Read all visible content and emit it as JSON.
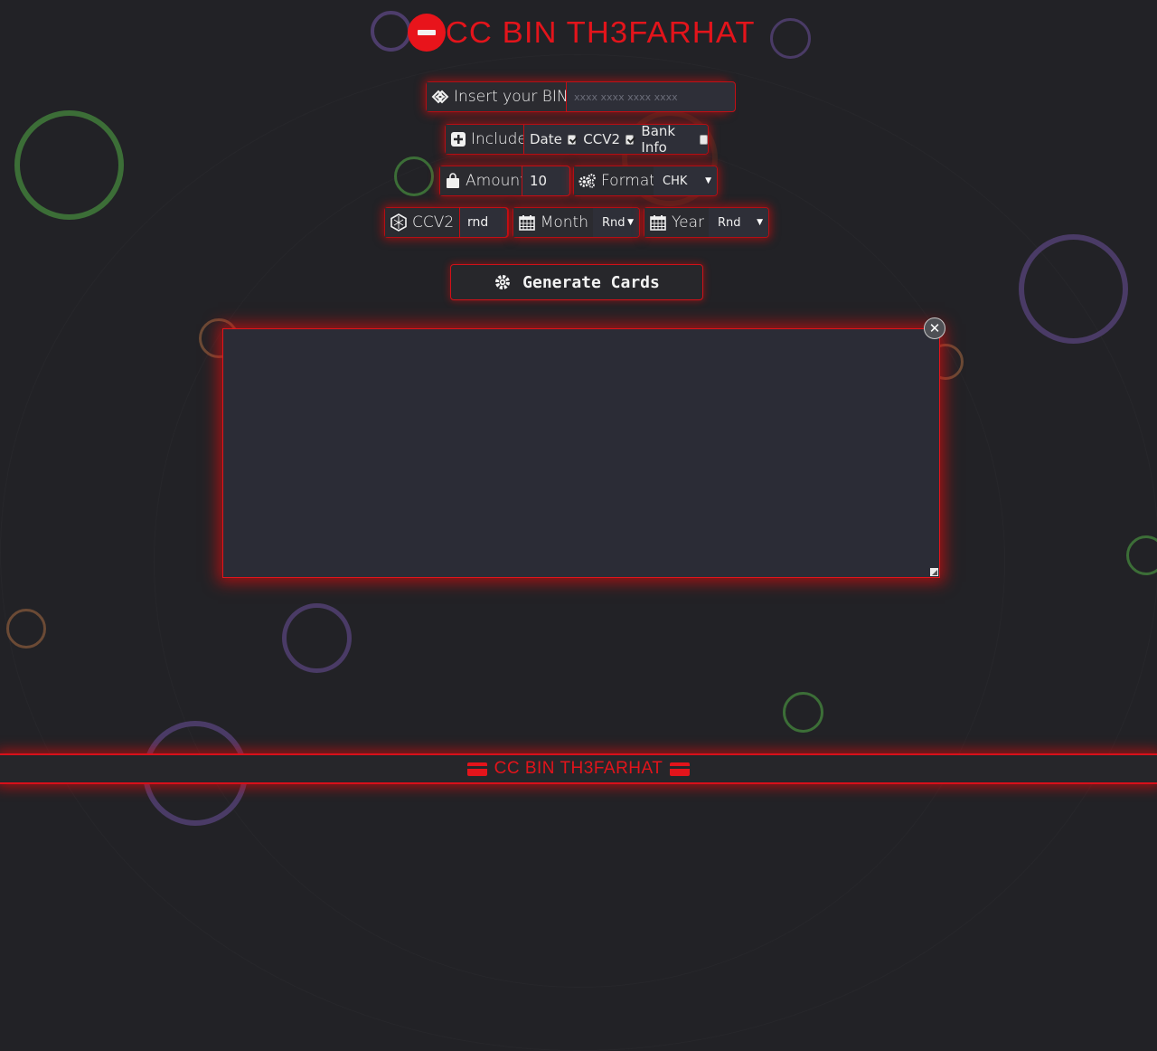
{
  "header": {
    "title": "CC BIN TH3FARHAT"
  },
  "bin_row": {
    "label": "Insert your BIN",
    "placeholder": "xxxx xxxx xxxx xxxx",
    "value": ""
  },
  "include_row": {
    "label": "Include",
    "options": [
      {
        "label": "Date",
        "checked": true
      },
      {
        "label": "CCV2",
        "checked": true
      },
      {
        "label": "Bank Info",
        "checked": false
      }
    ]
  },
  "amount_row": {
    "label": "Amount",
    "value": "10"
  },
  "format_row": {
    "label": "Format",
    "selected": "CHK"
  },
  "ccv_row": {
    "label": "CCV2",
    "value": "rnd"
  },
  "month_row": {
    "label": "Month",
    "selected": "Rnd"
  },
  "year_row": {
    "label": "Year",
    "selected": "Rnd"
  },
  "generate": {
    "label": "Generate Cards"
  },
  "output": {
    "value": ""
  },
  "footer": {
    "text": "CC BIN TH3FARHAT"
  },
  "colors": {
    "accent": "#e3141b",
    "background": "#222226",
    "panel": "#2b2c36"
  }
}
